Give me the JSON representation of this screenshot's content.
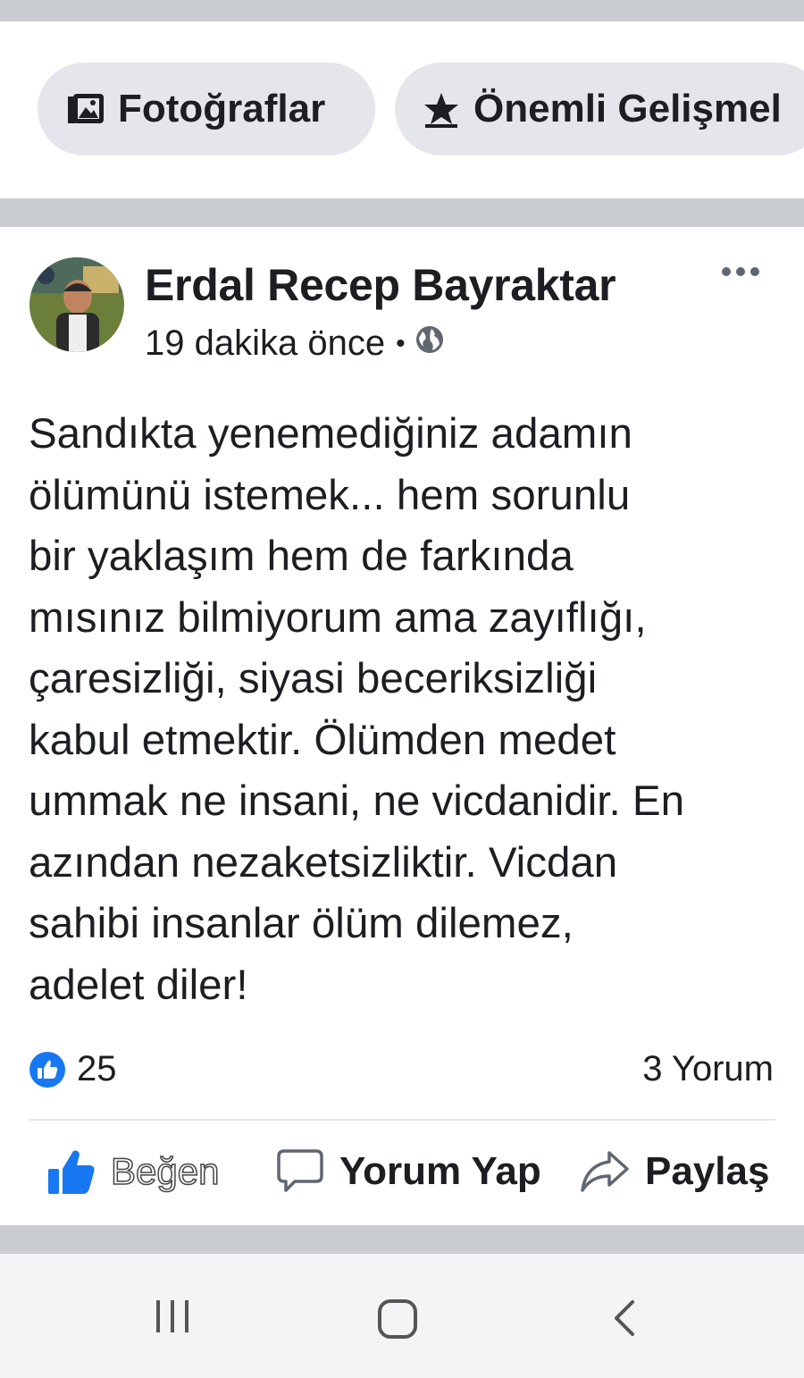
{
  "tabs": {
    "photos_label": "Fotoğraflar",
    "highlights_label": "Önemli Gelişmel"
  },
  "post": {
    "author": "Erdal Recep Bayraktar",
    "time": "19 dakika önce",
    "privacy_icon": "globe-icon",
    "text": "Sandıkta yenemediğiniz adamın\nölümünü istemek... hem sorunlu\nbir yaklaşım hem de farkında\nmısınız bilmiyorum ama zayıflığı,\nçaresizliği, siyasi beceriksizliği\nkabul etmektir. Ölümden medet\nummak ne insani, ne vicdanidir. En\nazından nezaketsizliktir. Vicdan\nsahibi insanlar ölüm dilemez,\nadelet diler!",
    "reaction_count": "25",
    "comment_count": "3 Yorum"
  },
  "actions": {
    "like_label": "Beğen",
    "comment_label": "Yorum Yap",
    "share_label": "Paylaş"
  },
  "colors": {
    "accent": "#1877f2",
    "chip_bg": "#e4e6eb",
    "separator": "#c9ccd1"
  }
}
